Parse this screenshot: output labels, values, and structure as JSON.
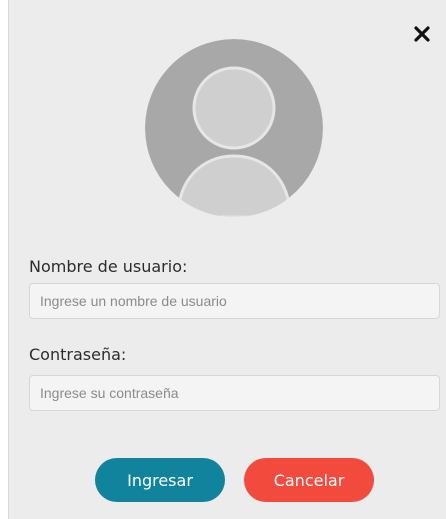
{
  "dialog": {
    "close_icon": "close-icon",
    "avatar_icon": "user-avatar-icon",
    "form": {
      "username_label": "Nombre de usuario:",
      "username_placeholder": "Ingrese un nombre de usuario",
      "username_value": "",
      "password_label": "Contraseña:",
      "password_placeholder": "Ingrese su contraseña",
      "password_value": ""
    },
    "buttons": {
      "login_label": "Ingresar",
      "cancel_label": "Cancelar"
    }
  },
  "colors": {
    "dialog_background": "#ececec",
    "login_button": "#11839d",
    "cancel_button": "#f24a3d",
    "avatar_circle": "#a8a8a8",
    "avatar_figure": "#cfcfcf"
  }
}
